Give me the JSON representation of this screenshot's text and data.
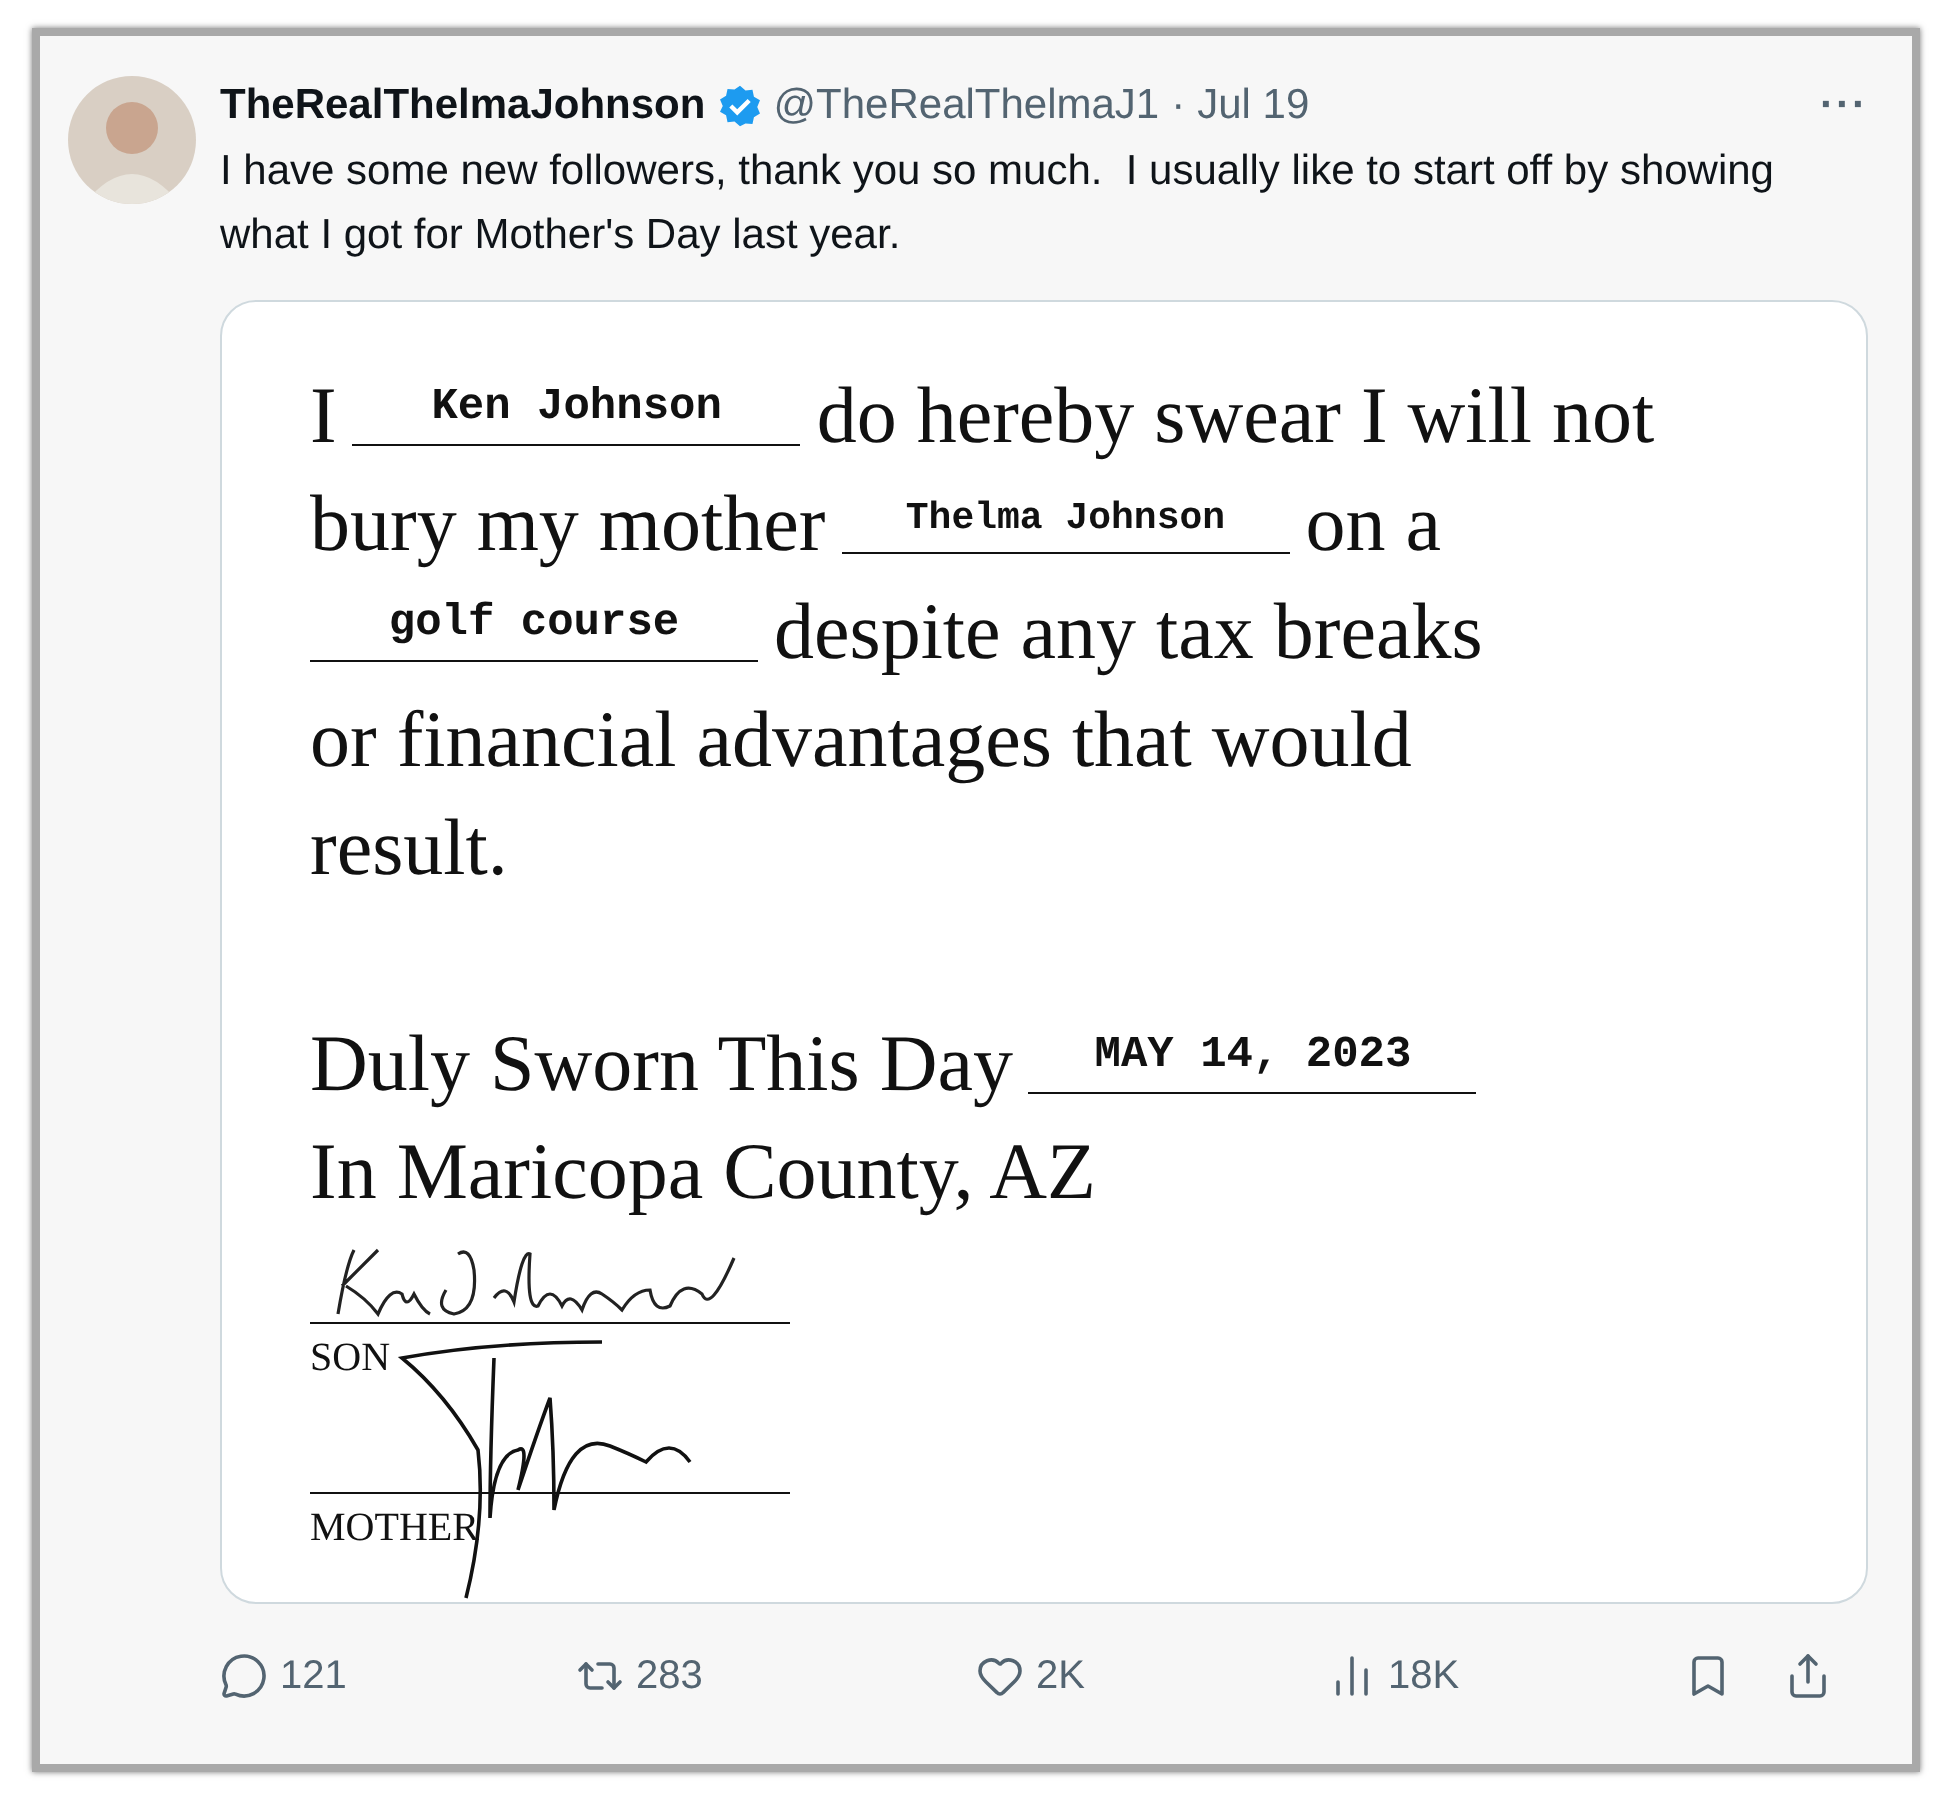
{
  "post": {
    "author": {
      "name": "TheRealThelmaJohnson",
      "verified": true,
      "handle": "@TheRealThelmaJ1",
      "separator": "·",
      "date": "Jul 19"
    },
    "more": "···",
    "text": "I have some new followers, thank you so much.  I usually like to start off by showing what I got for Mother's Day last year."
  },
  "document": {
    "paragraph": [
      [
        {
          "kind": "text",
          "text": "I"
        },
        {
          "kind": "blank",
          "value": "Ken Johnson"
        },
        {
          "kind": "text",
          "text": "do hereby swear I will not"
        }
      ],
      [
        {
          "kind": "text",
          "text": "bury my mother"
        },
        {
          "kind": "blank",
          "value": "Thelma Johnson",
          "small": true
        },
        {
          "kind": "text",
          "text": "on a"
        }
      ],
      [
        {
          "kind": "blank",
          "value": "golf course"
        },
        {
          "kind": "text",
          "text": "despite any tax breaks"
        }
      ],
      [
        {
          "kind": "text",
          "text": "or financial advantages that would"
        }
      ],
      [
        {
          "kind": "text",
          "text": "result."
        }
      ]
    ],
    "sworn": [
      {
        "kind": "text",
        "text": "Duly Sworn This Day"
      },
      {
        "kind": "blank",
        "value": "MAY 14, 2023"
      }
    ],
    "place": "In Maricopa County, AZ",
    "signatures": [
      {
        "role": "SON"
      },
      {
        "role": "MOTHER"
      }
    ]
  },
  "actions": [
    {
      "kind": "reply",
      "count": "121"
    },
    {
      "kind": "repost",
      "count": "283"
    },
    {
      "kind": "like",
      "count": "2K"
    },
    {
      "kind": "views",
      "count": "18K"
    },
    {
      "kind": "bookmark"
    },
    {
      "kind": "share"
    }
  ]
}
